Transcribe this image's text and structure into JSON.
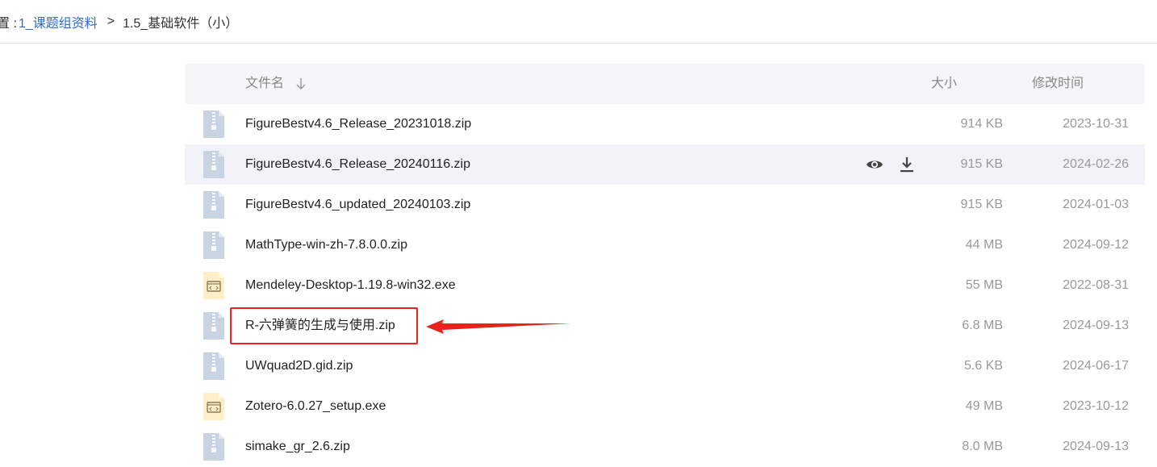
{
  "breadcrumb": {
    "prefix": "置 :",
    "parent": "1_课题组资料",
    "separator": ">",
    "current": "1.5_基础软件（小）"
  },
  "table": {
    "headers": {
      "name": "文件名",
      "size": "大小",
      "modified": "修改时间"
    },
    "sort_icon": "arrow-down-icon",
    "row_actions": [
      "eye-icon",
      "download-icon"
    ],
    "rows": [
      {
        "name": "FigureBestv4.6_Release_20231018.zip",
        "size": "914 KB",
        "modified": "2023-10-31",
        "icon": "zip-file-icon"
      },
      {
        "name": "FigureBestv4.6_Release_20240116.zip",
        "size": "915 KB",
        "modified": "2024-02-26",
        "icon": "zip-file-icon",
        "hovered": true
      },
      {
        "name": "FigureBestv4.6_updated_20240103.zip",
        "size": "915 KB",
        "modified": "2024-01-03",
        "icon": "zip-file-icon"
      },
      {
        "name": "MathType-win-zh-7.8.0.0.zip",
        "size": "44 MB",
        "modified": "2024-09-12",
        "icon": "zip-file-icon"
      },
      {
        "name": "Mendeley-Desktop-1.19.8-win32.exe",
        "size": "55 MB",
        "modified": "2022-08-31",
        "icon": "exe-file-icon"
      },
      {
        "name": "R-六弹簧的生成与使用.zip",
        "size": "6.8 MB",
        "modified": "2024-09-13",
        "icon": "zip-file-icon",
        "highlighted": true
      },
      {
        "name": "UWquad2D.gid.zip",
        "size": "5.6 KB",
        "modified": "2024-06-17",
        "icon": "zip-file-icon"
      },
      {
        "name": "Zotero-6.0.27_setup.exe",
        "size": "49 MB",
        "modified": "2023-10-12",
        "icon": "exe-file-icon"
      },
      {
        "name": "simake_gr_2.6.zip",
        "size": "8.0 MB",
        "modified": "2024-09-13",
        "icon": "zip-file-icon"
      }
    ]
  },
  "colors": {
    "link": "#2f6ec7",
    "highlight": "#e8231b",
    "zip_icon": "#c9d4e3",
    "exe_icon": "#fdf0c8"
  }
}
